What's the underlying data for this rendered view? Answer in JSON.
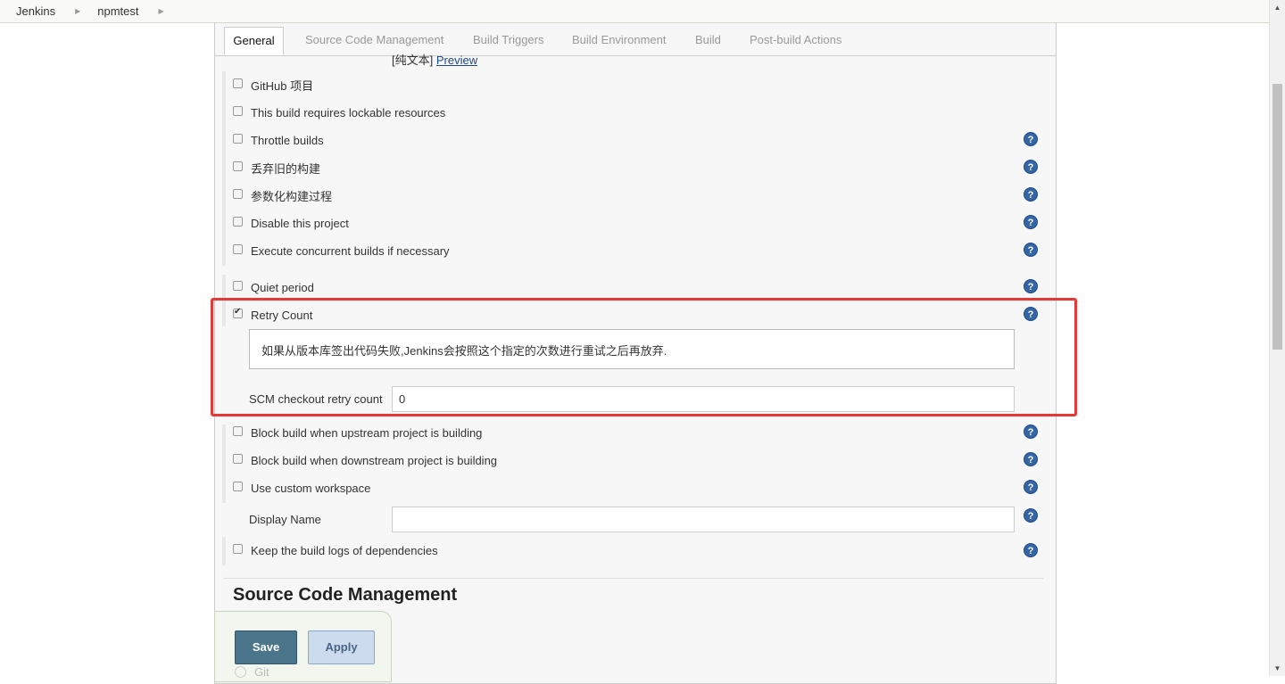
{
  "breadcrumb": {
    "items": [
      "Jenkins",
      "npmtest"
    ]
  },
  "tabs": [
    "General",
    "Source Code Management",
    "Build Triggers",
    "Build Environment",
    "Build",
    "Post-build Actions"
  ],
  "description": {
    "plain_text": "[纯文本]",
    "preview_link": "Preview"
  },
  "options": [
    {
      "label": "GitHub 项目",
      "checked": false
    },
    {
      "label": "This build requires lockable resources",
      "checked": false
    },
    {
      "label": "Throttle builds",
      "checked": false
    },
    {
      "label": "丢弃旧的构建",
      "checked": false
    },
    {
      "label": "参数化构建过程",
      "checked": false
    },
    {
      "label": "Disable this project",
      "checked": false
    },
    {
      "label": "Execute concurrent builds if necessary",
      "checked": false
    },
    {
      "label": "Quiet period",
      "checked": false
    },
    {
      "label": "Retry Count",
      "checked": true
    },
    {
      "label": "Block build when upstream project is building",
      "checked": false
    },
    {
      "label": "Block build when downstream project is building",
      "checked": false
    },
    {
      "label": "Use custom workspace",
      "checked": false
    },
    {
      "label": "Keep the build logs of dependencies",
      "checked": false
    }
  ],
  "retry": {
    "help_text": "如果从版本库签出代码失败,Jenkins会按照这个指定的次数进行重试之后再放弃.",
    "field_label": "SCM checkout retry count",
    "field_value": "0"
  },
  "display_name": {
    "label": "Display Name",
    "value": ""
  },
  "help_icon_glyph": "?",
  "scm_section": {
    "title": "Source Code Management",
    "git_label": "Git"
  },
  "buttons": {
    "save": "Save",
    "apply": "Apply"
  },
  "colors": {
    "highlight": "#e53935",
    "help_icon": "#3465a4",
    "save_button": "#4b758b"
  }
}
